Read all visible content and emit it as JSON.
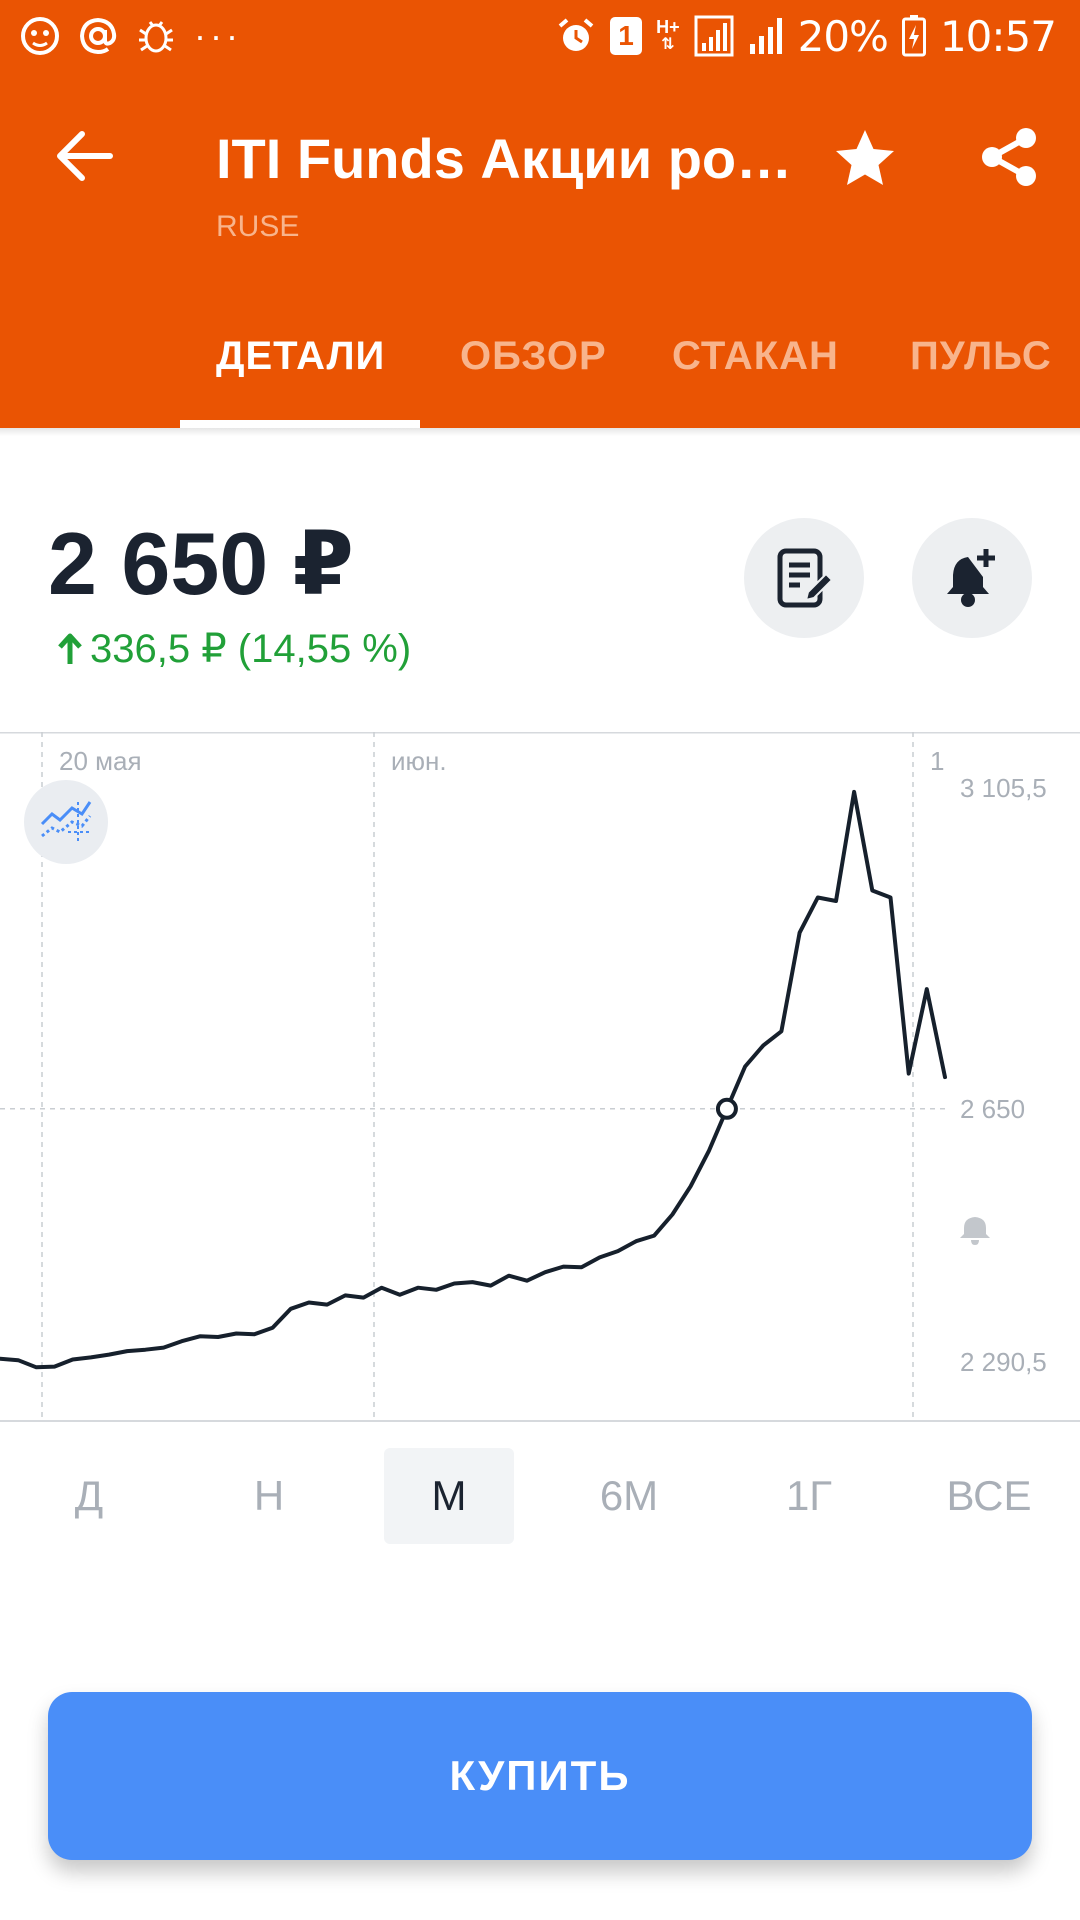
{
  "status_bar": {
    "icons": [
      "lion-app-icon",
      "at-sign-icon",
      "bug-icon",
      "more-dots-icon",
      "alarm-icon",
      "sim1-icon",
      "network-h-plus-icon",
      "signal-icon",
      "signal-icon-2",
      "battery-charging-icon"
    ],
    "more": "···",
    "sim_badge": "1",
    "network": "H+",
    "battery": "20%",
    "time": "10:57"
  },
  "header": {
    "title": "ITI Funds Акции ро…",
    "subtitle": "RUSE",
    "icons": {
      "back": "arrow-left-icon",
      "favorite": "star-icon",
      "share": "share-icon"
    },
    "tabs": [
      {
        "label": "ДЕТАЛИ",
        "active": true
      },
      {
        "label": "ОБЗОР",
        "active": false
      },
      {
        "label": "СТАКАН",
        "active": false
      },
      {
        "label": "ПУЛЬС",
        "active": false
      }
    ]
  },
  "quote": {
    "price": "2 650 ₽",
    "change": "336,5 ₽ (14,55 %)",
    "change_direction": "up",
    "change_icon": "arrow-up-icon",
    "buttons": {
      "notes": "note-edit-icon",
      "alert": "bell-plus-icon"
    }
  },
  "chart_data": {
    "type": "line",
    "x_tick_labels": [
      "20 мая",
      "июн.",
      "1"
    ],
    "y_tick_labels": [
      "3 105,5",
      "2 650",
      "2 290,5"
    ],
    "ylim": [
      2290.5,
      3105.5
    ],
    "current_value": 2650,
    "marker_value": 2650,
    "toggle_icon": "chart-type-icon",
    "alert_icon": "bell-icon",
    "series": [
      {
        "values": [
          2295,
          2293,
          2283,
          2284,
          2294,
          2297,
          2301,
          2306,
          2308,
          2311,
          2320,
          2327,
          2326,
          2331,
          2330,
          2339,
          2366,
          2375,
          2372,
          2385,
          2382,
          2396,
          2386,
          2396,
          2393,
          2402,
          2404,
          2399,
          2413,
          2406,
          2418,
          2426,
          2425,
          2439,
          2448,
          2462,
          2470,
          2500,
          2540,
          2590,
          2650,
          2710,
          2740,
          2760,
          2900,
          2950,
          2945,
          3100,
          2960,
          2950,
          2700,
          2820,
          2695
        ]
      }
    ]
  },
  "periods": [
    {
      "label": "Д",
      "active": false
    },
    {
      "label": "Н",
      "active": false
    },
    {
      "label": "М",
      "active": true
    },
    {
      "label": "6М",
      "active": false
    },
    {
      "label": "1Г",
      "active": false
    },
    {
      "label": "ВСЕ",
      "active": false
    }
  ],
  "buy_button": {
    "label": "КУПИТЬ"
  },
  "colors": {
    "header_bg": "#EA5403",
    "tab_inactive": "#F8B48C",
    "price_text": "#1B2330",
    "positive": "#21A038",
    "buy_button": "#4A8EF8",
    "chart_line": "#16202C",
    "grid": "#C9CDD2"
  }
}
